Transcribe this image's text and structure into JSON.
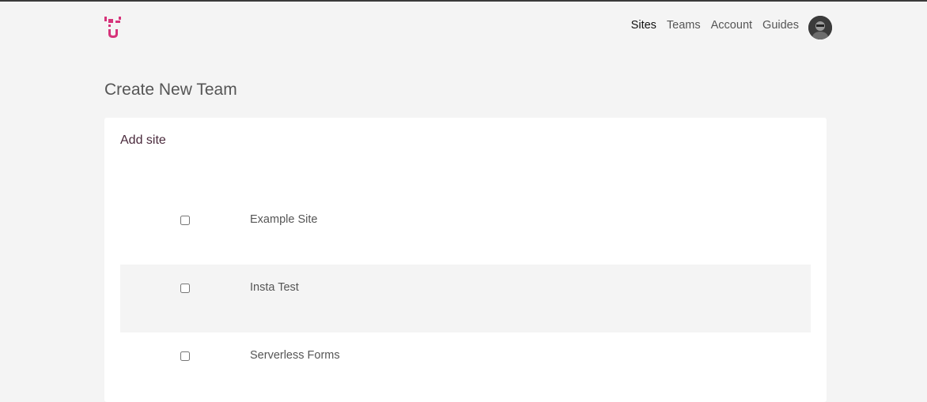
{
  "header": {
    "logo_icon": "brand-logo-icon",
    "nav": [
      {
        "label": "Sites",
        "active": true
      },
      {
        "label": "Teams",
        "active": false
      },
      {
        "label": "Account",
        "active": false
      },
      {
        "label": "Guides",
        "active": false
      }
    ],
    "avatar_icon": "user-avatar"
  },
  "main": {
    "title": "Create New Team",
    "card": {
      "title": "Add site",
      "sites": [
        {
          "name": "Example Site",
          "checked": false
        },
        {
          "name": "Insta Test",
          "checked": false
        },
        {
          "name": "Serverless Forms",
          "checked": false
        }
      ]
    }
  },
  "colors": {
    "brand": "#d6337a",
    "background": "#f4f4f4",
    "card": "#ffffff"
  }
}
